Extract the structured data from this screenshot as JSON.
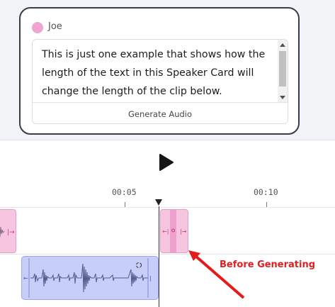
{
  "speaker_card": {
    "speaker_name": "Joe",
    "speaker_color": "#f0a5cf",
    "text": "This is just one example that shows how the length of the text in this Speaker Card will change the length of the clip below.",
    "generate_button_label": "Generate Audio"
  },
  "timeline": {
    "time_labels": [
      "00:05",
      "00:10"
    ],
    "play_icon": "play-icon",
    "annotation": "Before Generating",
    "annotation_color": "#e02020",
    "clip_colors": {
      "pink": "#f6c6e1",
      "blue": "#c7cff8"
    }
  }
}
